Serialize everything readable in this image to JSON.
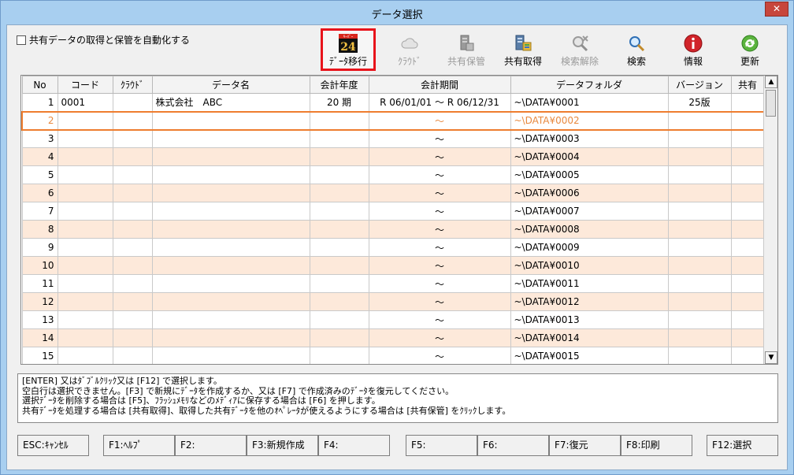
{
  "window": {
    "title": "データ選択",
    "close_label": "✕"
  },
  "options": {
    "auto_sync_label": "共有データの取得と保管を自動化する",
    "auto_sync_checked": false
  },
  "toolbar": {
    "buttons": [
      {
        "label": "ﾃﾞｰﾀ移行",
        "icon": "data-migration-24-icon",
        "enabled": true,
        "highlighted": true
      },
      {
        "label": "ｸﾗｳﾄﾞ",
        "icon": "cloud-icon",
        "enabled": false
      },
      {
        "label": "共有保管",
        "icon": "shared-storage-icon",
        "enabled": false
      },
      {
        "label": "共有取得",
        "icon": "shared-fetch-icon",
        "enabled": true
      },
      {
        "label": "検索解除",
        "icon": "clear-search-icon",
        "enabled": false
      },
      {
        "label": "検索",
        "icon": "search-icon",
        "enabled": true
      },
      {
        "label": "情報",
        "icon": "info-icon",
        "enabled": true
      },
      {
        "label": "更新",
        "icon": "refresh-icon",
        "enabled": true
      }
    ],
    "icon_badge_text": "24",
    "icon_badge_top": "ｷｰﾊﾟｰ"
  },
  "table": {
    "columns": [
      "No",
      "コード",
      "ｸﾗｳﾄﾞ",
      "データ名",
      "会計年度",
      "会計期間",
      "データフォルダ",
      "バージョン",
      "共有"
    ],
    "rows": [
      [
        "1",
        "0001",
        "",
        "株式会社　ABC",
        "20 期",
        "R 06/01/01 〜 R 06/12/31",
        "~\\DATA¥0001",
        "25版",
        ""
      ],
      [
        "2",
        "",
        "",
        "",
        "",
        "〜",
        "~\\DATA¥0002",
        "",
        ""
      ],
      [
        "3",
        "",
        "",
        "",
        "",
        "〜",
        "~\\DATA¥0003",
        "",
        ""
      ],
      [
        "4",
        "",
        "",
        "",
        "",
        "〜",
        "~\\DATA¥0004",
        "",
        ""
      ],
      [
        "5",
        "",
        "",
        "",
        "",
        "〜",
        "~\\DATA¥0005",
        "",
        ""
      ],
      [
        "6",
        "",
        "",
        "",
        "",
        "〜",
        "~\\DATA¥0006",
        "",
        ""
      ],
      [
        "7",
        "",
        "",
        "",
        "",
        "〜",
        "~\\DATA¥0007",
        "",
        ""
      ],
      [
        "8",
        "",
        "",
        "",
        "",
        "〜",
        "~\\DATA¥0008",
        "",
        ""
      ],
      [
        "9",
        "",
        "",
        "",
        "",
        "〜",
        "~\\DATA¥0009",
        "",
        ""
      ],
      [
        "10",
        "",
        "",
        "",
        "",
        "〜",
        "~\\DATA¥0010",
        "",
        ""
      ],
      [
        "11",
        "",
        "",
        "",
        "",
        "〜",
        "~\\DATA¥0011",
        "",
        ""
      ],
      [
        "12",
        "",
        "",
        "",
        "",
        "〜",
        "~\\DATA¥0012",
        "",
        ""
      ],
      [
        "13",
        "",
        "",
        "",
        "",
        "〜",
        "~\\DATA¥0013",
        "",
        ""
      ],
      [
        "14",
        "",
        "",
        "",
        "",
        "〜",
        "~\\DATA¥0014",
        "",
        ""
      ],
      [
        "15",
        "",
        "",
        "",
        "",
        "〜",
        "~\\DATA¥0015",
        "",
        ""
      ]
    ],
    "selected_row": 2
  },
  "help_lines": [
    "[ENTER] 又はﾀﾞﾌﾞﾙｸﾘｯｸ又は [F12] で選択します。",
    "空白行は選択できません。[F3] で新規にﾃﾞｰﾀを作成するか、又は [F7] で作成済みのﾃﾞｰﾀを復元してください。",
    "選択ﾃﾞｰﾀを削除する場合は [F5]、ﾌﾗｯｼｭﾒﾓﾘなどのﾒﾃﾞｨｱに保存する場合は [F6] を押します。",
    "共有ﾃﾞｰﾀを処理する場合は [共有取得]、取得した共有ﾃﾞｰﾀを他のｵﾍﾟﾚｰﾀが使えるようにする場合は [共有保管] をｸﾘｯｸします。"
  ],
  "fkeys": [
    "ESC:ｷｬﾝｾﾙ",
    "F1:ﾍﾙﾌﾟ",
    "F2:",
    "F3:新規作成",
    "F4:",
    "F5:",
    "F6:",
    "F7:復元",
    "F8:印刷",
    "F12:選択"
  ],
  "colors": {
    "accent_highlight": "#e8131b",
    "selected_row_border": "#ee7d2f",
    "alt_row_bg": "#fde9da",
    "window_frame": "#a8cff0"
  }
}
